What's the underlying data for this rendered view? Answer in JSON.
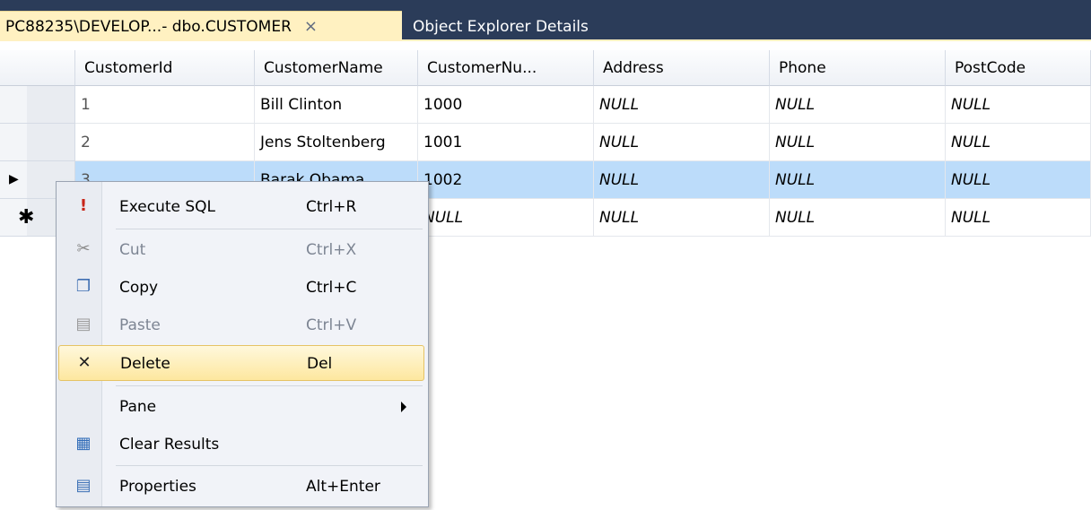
{
  "tabs": {
    "active_label": "PC88235\\DEVELOP...- dbo.CUSTOMER",
    "close_glyph": "×",
    "inactive_label": "Object Explorer Details"
  },
  "grid": {
    "columns": [
      "CustomerId",
      "CustomerName",
      "CustomerNu...",
      "Address",
      "Phone",
      "PostCode"
    ],
    "rows": [
      {
        "CustomerId": "1",
        "CustomerName": "Bill Clinton",
        "CustomerNumber": "1000",
        "Address": "NULL",
        "Phone": "NULL",
        "PostCode": "NULL"
      },
      {
        "CustomerId": "2",
        "CustomerName": "Jens Stoltenberg",
        "CustomerNumber": "1001",
        "Address": "NULL",
        "Phone": "NULL",
        "PostCode": "NULL"
      },
      {
        "CustomerId": "3",
        "CustomerName": "Barak Obama",
        "CustomerNumber": "1002",
        "Address": "NULL",
        "Phone": "NULL",
        "PostCode": "NULL"
      },
      {
        "CustomerId": "",
        "CustomerName": "",
        "CustomerNumber": "NULL",
        "Address": "NULL",
        "Phone": "NULL",
        "PostCode": "NULL"
      }
    ],
    "current_row_glyph": "▶",
    "new_row_glyph": "✱"
  },
  "context_menu": {
    "items": [
      {
        "label": "Execute SQL",
        "shortcut": "Ctrl+R",
        "icon": "execute-sql-icon",
        "enabled": true
      },
      {
        "label": "Cut",
        "shortcut": "Ctrl+X",
        "icon": "scissors-icon",
        "enabled": false
      },
      {
        "label": "Copy",
        "shortcut": "Ctrl+C",
        "icon": "copy-icon",
        "enabled": true
      },
      {
        "label": "Paste",
        "shortcut": "Ctrl+V",
        "icon": "paste-icon",
        "enabled": false
      },
      {
        "label": "Delete",
        "shortcut": "Del",
        "icon": "delete-x-icon",
        "enabled": true,
        "highlighted": true
      },
      {
        "label": "Pane",
        "shortcut": "",
        "icon": "",
        "enabled": true,
        "submenu": true
      },
      {
        "label": "Clear Results",
        "shortcut": "",
        "icon": "clear-results-icon",
        "enabled": true
      },
      {
        "label": "Properties",
        "shortcut": "Alt+Enter",
        "icon": "properties-icon",
        "enabled": true
      }
    ]
  },
  "colors": {
    "tabstrip": "#2b3c59",
    "active_tab": "#fff1c1",
    "selected_row": "#bcdcfa",
    "menu_highlight": "#fde79f"
  }
}
